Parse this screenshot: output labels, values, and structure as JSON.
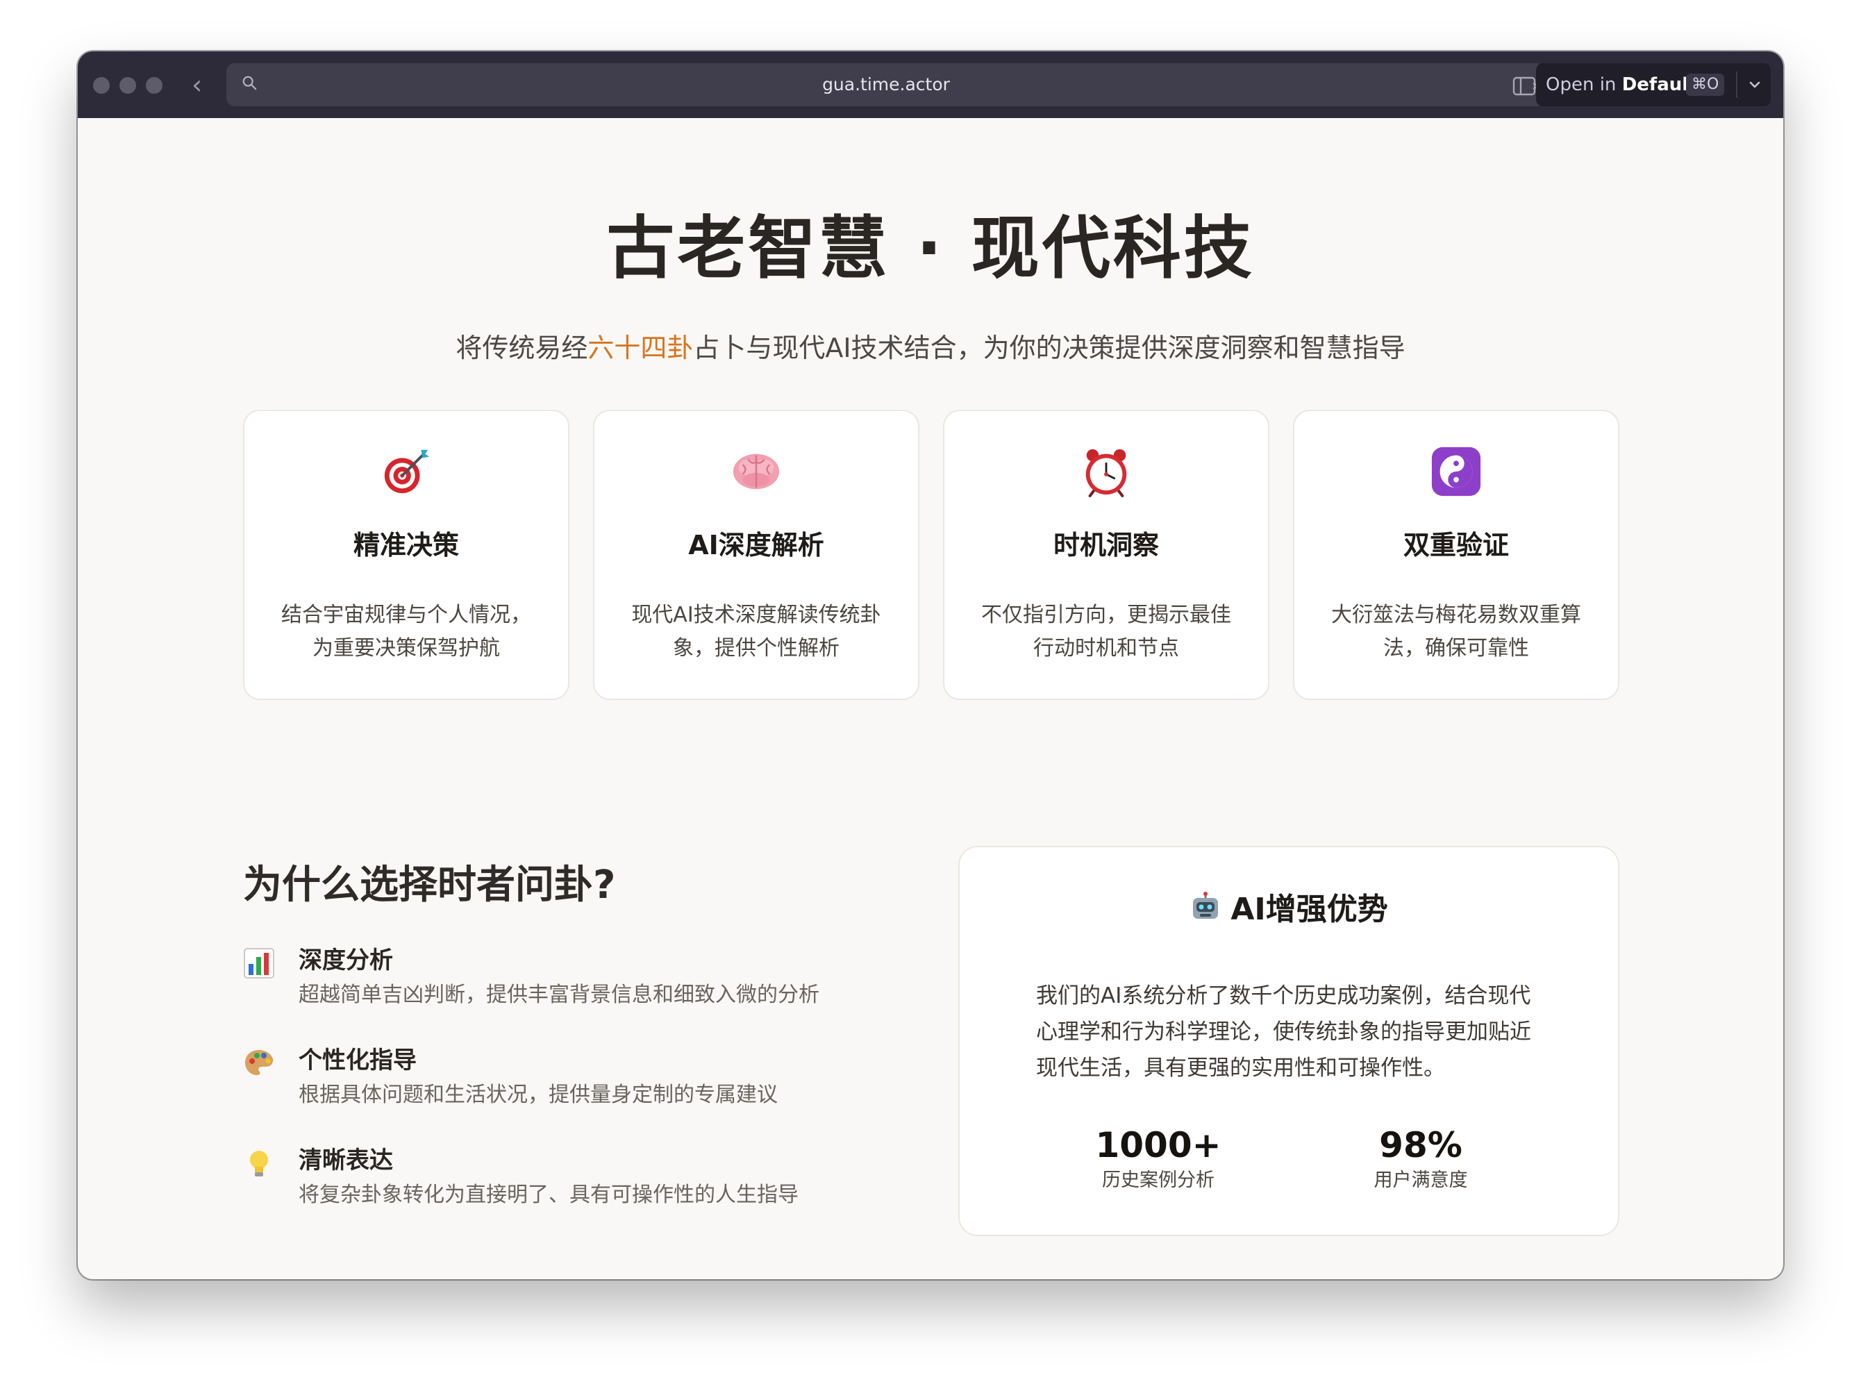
{
  "browser": {
    "url": "gua.time.actor",
    "open_prefix": "Open in",
    "open_target": "Default",
    "shortcut": "⌘O",
    "back_glyph": "‹"
  },
  "hero": {
    "title": "古老智慧 · 现代科技",
    "subtitle_before": "将传统易经",
    "subtitle_highlight": "六十四卦",
    "subtitle_after": "占卜与现代AI技术结合，为你的决策提供深度洞察和智慧指导",
    "highlight_color": "#d9741f"
  },
  "cards": [
    {
      "icon": "target-icon",
      "title": "精准决策",
      "desc": "结合宇宙规律与个人情况，为重要决策保驾护航"
    },
    {
      "icon": "brain-icon",
      "title": "AI深度解析",
      "desc": "现代AI技术深度解读传统卦象，提供个性解析"
    },
    {
      "icon": "alarm-clock-icon",
      "title": "时机洞察",
      "desc": "不仅指引方向，更揭示最佳行动时机和节点"
    },
    {
      "icon": "yin-yang-icon",
      "title": "双重验证",
      "desc": "大衍筮法与梅花易数双重算法，确保可靠性"
    }
  ],
  "why": {
    "title": "为什么选择时者问卦?",
    "features": [
      {
        "icon": "bar-chart-icon",
        "title": "深度分析",
        "desc": "超越简单吉凶判断，提供丰富背景信息和细致入微的分析"
      },
      {
        "icon": "palette-icon",
        "title": "个性化指导",
        "desc": "根据具体问题和生活状况，提供量身定制的专属建议"
      },
      {
        "icon": "light-bulb-icon",
        "title": "清晰表达",
        "desc": "将复杂卦象转化为直接明了、具有可操作性的人生指导"
      }
    ]
  },
  "ai_panel": {
    "icon": "robot-icon",
    "title": "AI增强优势",
    "text": "我们的AI系统分析了数千个历史成功案例，结合现代心理学和行为科学理论，使传统卦象的指导更加贴近现代生活，具有更强的实用性和可操作性。",
    "stats": [
      {
        "value": "1000+",
        "label": "历史案例分析"
      },
      {
        "value": "98%",
        "label": "用户满意度"
      }
    ]
  }
}
